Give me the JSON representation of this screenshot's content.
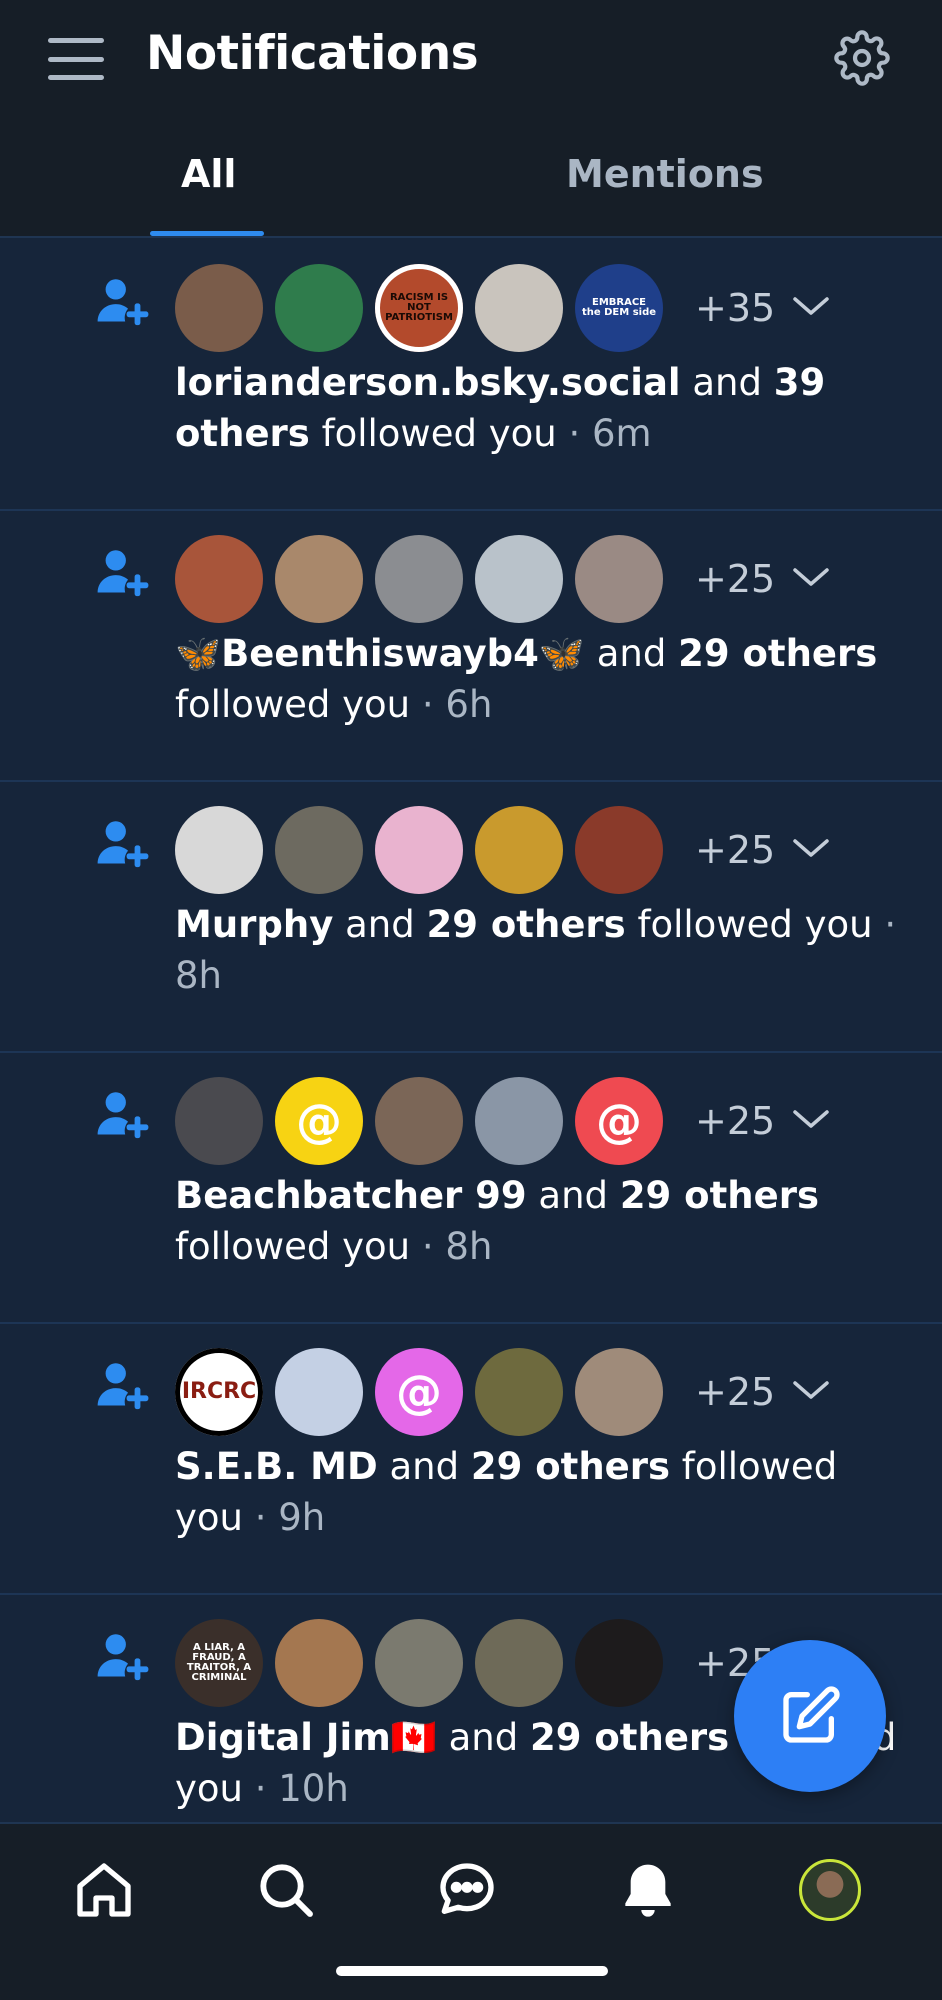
{
  "header": {
    "title": "Notifications",
    "menu_icon": "hamburger-menu-icon",
    "settings_icon": "gear-icon"
  },
  "tabs": [
    {
      "label": "All",
      "active": true
    },
    {
      "label": "Mentions",
      "active": false
    }
  ],
  "notifications": [
    {
      "more_count": "+35",
      "actor": "lorianderson.bsky.social",
      "connector": " and ",
      "others": "39 others",
      "action": " followed you",
      "time": " · 6m",
      "avatars": [
        {
          "bg": "#7a5c4a",
          "text": ""
        },
        {
          "bg": "#2f7c4c",
          "text": ""
        },
        {
          "bg": "#b34a2c",
          "text": "RACISM IS NOT PATRIOTISM",
          "ring": "#ffffff"
        },
        {
          "bg": "#c9c4bd",
          "text": ""
        },
        {
          "bg": "#1f3f8a",
          "text": "EMBRACE the DEM side"
        }
      ]
    },
    {
      "more_count": "+25",
      "actor": "🦋Beenthiswayb4🦋",
      "connector": " and ",
      "others": "29 others",
      "action": " followed you",
      "time": " · 6h",
      "avatars": [
        {
          "bg": "#a8553a",
          "text": ""
        },
        {
          "bg": "#a9886b",
          "text": ""
        },
        {
          "bg": "#8b8d91",
          "text": ""
        },
        {
          "bg": "#b9c2ca",
          "text": ""
        },
        {
          "bg": "#9a8a84",
          "text": ""
        }
      ]
    },
    {
      "more_count": "+25",
      "actor": "Murphy",
      "connector": " and ",
      "others": "29 others",
      "action": " followed you",
      "time": " · 8h",
      "avatars": [
        {
          "bg": "#d8d8d8",
          "text": ""
        },
        {
          "bg": "#6d6a60",
          "text": ""
        },
        {
          "bg": "#e9b3cf",
          "text": ""
        },
        {
          "bg": "#c99a2d",
          "text": ""
        },
        {
          "bg": "#8a3a2a",
          "text": ""
        }
      ]
    },
    {
      "more_count": "+25",
      "actor": "Beachbatcher 99",
      "connector": " and ",
      "others": "29 others",
      "action": " followed you",
      "time": " · 8h",
      "avatars": [
        {
          "bg": "#4a4a4f",
          "text": ""
        },
        {
          "bg": "#f7d313",
          "text": "@"
        },
        {
          "bg": "#7b6657",
          "text": ""
        },
        {
          "bg": "#8a96a6",
          "text": ""
        },
        {
          "bg": "#ef4a51",
          "text": "@"
        }
      ]
    },
    {
      "more_count": "+25",
      "actor": "S.E.B. MD",
      "connector": " and ",
      "others": "29 others",
      "action": " followed you",
      "time": " · 9h",
      "avatars": [
        {
          "bg": "#ffffff",
          "text": "IRCRC",
          "ring": "#000000"
        },
        {
          "bg": "#c4d0e4",
          "text": ""
        },
        {
          "bg": "#e468e8",
          "text": "@"
        },
        {
          "bg": "#6e6a3e",
          "text": ""
        },
        {
          "bg": "#9f8b7a",
          "text": ""
        }
      ]
    },
    {
      "more_count": "+25",
      "actor": "Digital Jim🇨🇦",
      "connector": " and ",
      "others": "29 others",
      "action": " followed you",
      "time": " · 10h",
      "avatars": [
        {
          "bg": "#3a2f2a",
          "text": "A LIAR, A FRAUD, A TRAITOR, A CRIMINAL"
        },
        {
          "bg": "#a47750",
          "text": ""
        },
        {
          "bg": "#7b7a6f",
          "text": ""
        },
        {
          "bg": "#6e6a58",
          "text": ""
        },
        {
          "bg": "#1d1b1c",
          "text": ""
        }
      ]
    }
  ],
  "fab": {
    "icon": "compose-icon"
  },
  "bottom_nav": [
    {
      "name": "home",
      "icon": "home-icon"
    },
    {
      "name": "search",
      "icon": "search-icon"
    },
    {
      "name": "chat",
      "icon": "chat-icon"
    },
    {
      "name": "notifications",
      "icon": "bell-icon"
    },
    {
      "name": "profile",
      "icon": "profile-avatar"
    }
  ],
  "colors": {
    "accent": "#2e8bef",
    "background": "#16253a",
    "header": "#161e27",
    "fab": "#2d7ff5"
  }
}
